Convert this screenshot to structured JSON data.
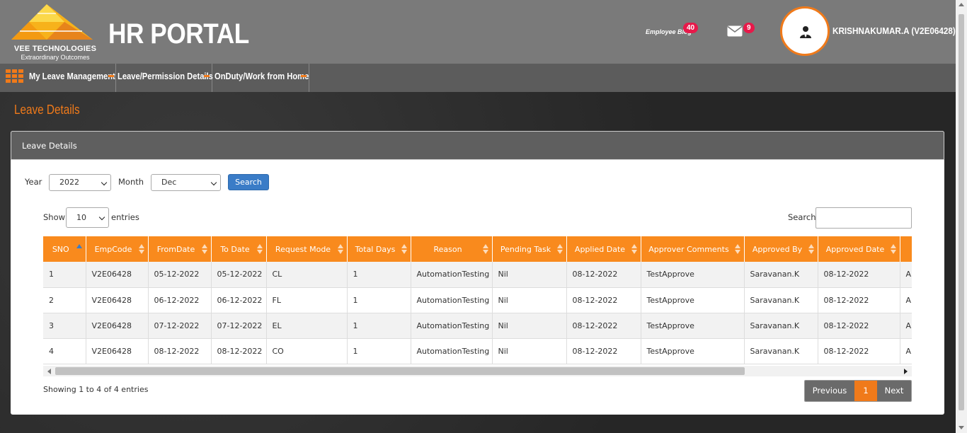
{
  "brand": {
    "company": "VEE TECHNOLOGIES",
    "tagline": "Extraordinary Outcomes",
    "portal_title": "HR PORTAL"
  },
  "header": {
    "blog_label": "Employee Blog",
    "blog_count": "40",
    "mail_count": "9",
    "user_name": "KRISHNAKUMAR.A (V2E06428)"
  },
  "nav": {
    "items": [
      {
        "label": "My Leave Management"
      },
      {
        "label": "Leave/Permission Details"
      },
      {
        "label": "OnDuty/Work from Home"
      }
    ]
  },
  "page": {
    "title": "Leave Details",
    "panel_title": "Leave Details"
  },
  "filters": {
    "year_label": "Year",
    "year_value": "2022",
    "month_label": "Month",
    "month_value": "Dec",
    "search_button": "Search"
  },
  "table_controls": {
    "show_label": "Show",
    "entries_value": "10",
    "entries_label": "entries",
    "search_label": "Search:"
  },
  "table": {
    "columns": [
      "SNO",
      "EmpCode",
      "FromDate",
      "To Date",
      "Request Mode",
      "Total Days",
      "Reason",
      "Pending Task",
      "Applied Date",
      "Approver Comments",
      "Approved By",
      "Approved Date",
      "A"
    ],
    "rows": [
      [
        "1",
        "V2E06428",
        "05-12-2022",
        "05-12-2022",
        "CL",
        "1",
        "AutomationTesting",
        "Nil",
        "08-12-2022",
        "TestApprove",
        "Saravanan.K",
        "08-12-2022",
        "A"
      ],
      [
        "2",
        "V2E06428",
        "06-12-2022",
        "06-12-2022",
        "FL",
        "1",
        "AutomationTesting",
        "Nil",
        "08-12-2022",
        "TestApprove",
        "Saravanan.K",
        "08-12-2022",
        "A"
      ],
      [
        "3",
        "V2E06428",
        "07-12-2022",
        "07-12-2022",
        "EL",
        "1",
        "AutomationTesting",
        "Nil",
        "08-12-2022",
        "TestApprove",
        "Saravanan.K",
        "08-12-2022",
        "A"
      ],
      [
        "4",
        "V2E06428",
        "08-12-2022",
        "08-12-2022",
        "CO",
        "1",
        "AutomationTesting",
        "Nil",
        "08-12-2022",
        "TestApprove",
        "Saravanan.K",
        "08-12-2022",
        "A"
      ]
    ]
  },
  "footer": {
    "info": "Showing 1 to 4 of 4 entries",
    "previous": "Previous",
    "current_page": "1",
    "next": "Next"
  },
  "colors": {
    "accent": "#f07a1a",
    "header_bg": "#7a7a7a",
    "table_header": "#f98a1d",
    "badge": "#e8194a",
    "search_button": "#3a7cc7"
  }
}
